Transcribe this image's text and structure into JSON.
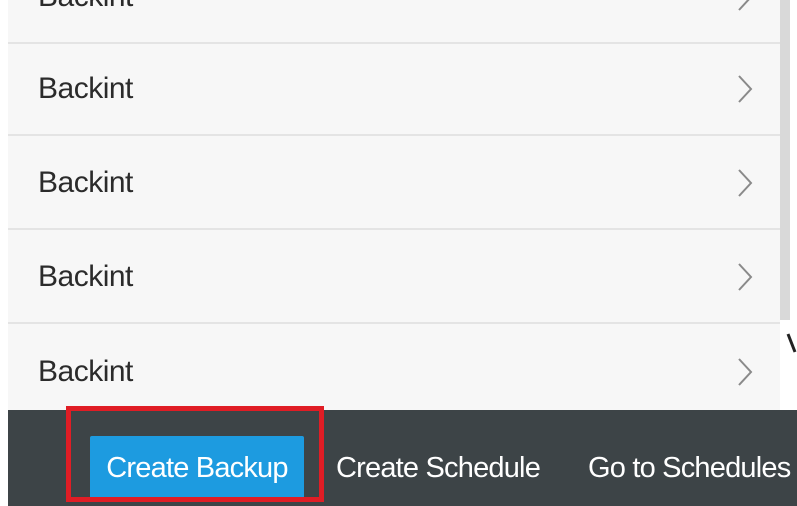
{
  "list": {
    "items": [
      {
        "label": "Backint"
      },
      {
        "label": "Backint"
      },
      {
        "label": "Backint"
      },
      {
        "label": "Backint"
      },
      {
        "label": "Backint"
      }
    ]
  },
  "footer": {
    "create_backup_label": "Create Backup",
    "create_schedule_label": "Create Schedule",
    "go_to_schedules_label": "Go to Schedules"
  },
  "colors": {
    "list_background": "#f7f7f7",
    "row_divider": "#e4e4e4",
    "footer_background": "#3d4447",
    "primary_button": "#1d9be0",
    "highlight_border": "#e01d25"
  },
  "icons": {
    "row_chevron": "chevron-right-icon"
  }
}
